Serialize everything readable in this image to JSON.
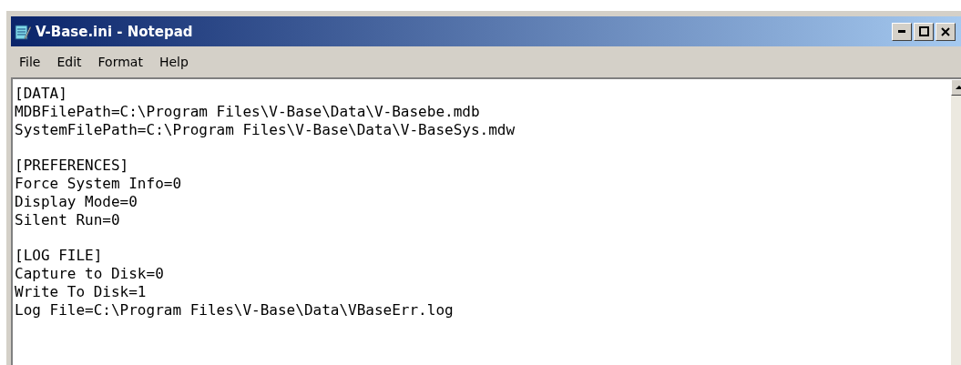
{
  "window": {
    "title": "V-Base.ini - Notepad"
  },
  "menu": [
    {
      "label": "File"
    },
    {
      "label": "Edit"
    },
    {
      "label": "Format"
    },
    {
      "label": "Help"
    }
  ],
  "document": {
    "sections": [
      {
        "header": "[DATA]",
        "lines": [
          "MDBFilePath=C:\\Program Files\\V-Base\\Data\\V-Basebe.mdb",
          "SystemFilePath=C:\\Program Files\\V-Base\\Data\\V-BaseSys.mdw"
        ]
      },
      {
        "header": "[PREFERENCES]",
        "lines": [
          "Force System Info=0",
          "Display Mode=0",
          "Silent Run=0"
        ]
      },
      {
        "header": "[LOG FILE]",
        "lines": [
          "Capture to Disk=0",
          "Write To Disk=1",
          "Log File=C:\\Program Files\\V-Base\\Data\\VBaseErr.log"
        ]
      }
    ]
  }
}
